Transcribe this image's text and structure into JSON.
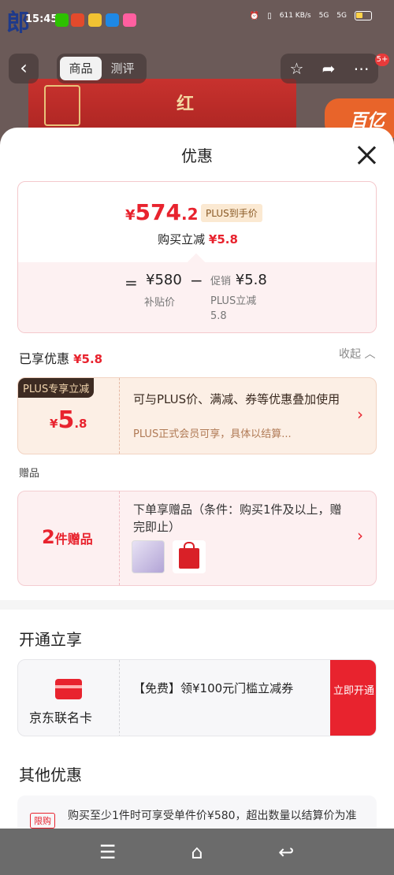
{
  "status_bar": {
    "time": "15:45",
    "net_speed": "611 KB/s",
    "signal1": "5G",
    "signal2": "5G",
    "logo_char": "郎"
  },
  "nav": {
    "back_icon": "‹",
    "tabs": [
      "商品",
      "测评"
    ],
    "badge": "5+"
  },
  "background": {
    "product_text": "红",
    "badge_text": "百亿"
  },
  "sheet": {
    "title": "优惠",
    "price_card": {
      "currency": "¥",
      "price_int": "574",
      "price_dec": ".2",
      "plus_tag": "PLUS到手价",
      "save_label": "购买立减",
      "save_value": "¥5.8",
      "equals": "=",
      "base_price": "¥580",
      "base_label": "补贴价",
      "minus": "−",
      "promo_prefix": "促销",
      "promo_value": "¥5.8",
      "promo_label": "PLUS立减",
      "promo_label_value": "5.8"
    },
    "enjoyed": {
      "label": "已享优惠",
      "value": "¥5.8",
      "collapse": "收起"
    },
    "plus_coupon": {
      "ribbon": "PLUS专享立减",
      "currency": "¥",
      "amount_int": "5",
      "amount_dec": ".8",
      "desc": "可与PLUS价、满减、券等优惠叠加使用",
      "sub": "PLUS正式会员可享，具体以结算..."
    },
    "gift_label": "赠品",
    "gift_card": {
      "count": "2",
      "count_suffix": "件赠品",
      "desc": "下单享赠品（条件：购买1件及以上，赠完即止）"
    },
    "open_title": "开通立享",
    "jd_card": {
      "name": "京东联名卡",
      "desc": "【免费】领¥100元门槛立减券",
      "button": "立即开通"
    },
    "other_title": "其他优惠",
    "other_card": {
      "tag": "限购",
      "text": "购买至少1件时可享受单件价¥580，超出数量以结算价为准"
    }
  },
  "colors": {
    "accent_red": "#e8232e",
    "plus_dark": "#3d2b22",
    "plus_gold": "#f1d5ae"
  },
  "icons": [
    "close-icon",
    "chevron-right-icon",
    "star-icon",
    "share-icon",
    "more-icon",
    "menu-icon",
    "home-icon",
    "back-nav-icon"
  ]
}
